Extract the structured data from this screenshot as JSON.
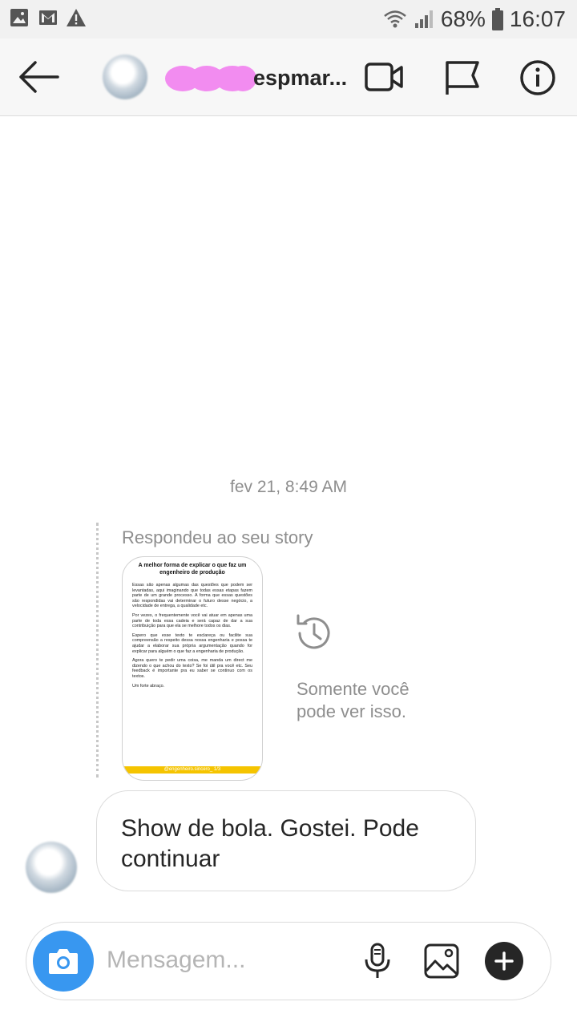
{
  "status_bar": {
    "battery": "68%",
    "time": "16:07",
    "left_icons": [
      "image-icon",
      "gmail-icon",
      "warning-icon"
    ],
    "right_icons": [
      "wifi-icon",
      "signal-icon",
      "battery-icon"
    ]
  },
  "header": {
    "username": "espmar...",
    "icons": [
      "back-arrow-icon",
      "video-call-icon",
      "flag-icon",
      "info-icon"
    ]
  },
  "chat": {
    "timestamp": "fev 21, 8:49 AM",
    "story_reply": {
      "label": "Respondeu ao seu story",
      "story_title": "A melhor forma de explicar o que faz um engenheiro de produção",
      "story_paragraphs": [
        "Essas são apenas algumas das questões que podem ser levantadas, aqui imaginando que todas essas etapas fazem parte de um grande processo. A forma que essas questões são respondidas vai determinar o futuro desse negócio, a velocidade de entrega, a qualidade etc.",
        "Por vezes, o frequentemente você vai atuar em apenas uma parte de toda essa cadeia e será capaz de dar a sua contribuição para que ela se melhore todos os dias.",
        "Espero que esse texto te esclareça ou facilite sua compreensão a respeito dessa nossa engenharia e possa te ajudar a elaborar sua própria argumentação quando for explicar para alguém o que faz a engenharia de produção.",
        "Agora quero te pedir uma coisa, me manda um direct me dizendo o que achou do texto? Se foi útil pra você etc. Seu feedback é importante pra eu saber se continuo com os textos.",
        "Um forte abraço."
      ],
      "story_footer": "@engenheiro.sincero_     1/3",
      "private_note": [
        "Somente você",
        "pode ver isso."
      ]
    },
    "message": "Show de bola.  Gostei.  Pode continuar"
  },
  "composer": {
    "placeholder": "Mensagem...",
    "icons": [
      "camera-icon",
      "microphone-icon",
      "gallery-icon",
      "plus-icon"
    ]
  },
  "colors": {
    "accent": "#3897f0",
    "username_blur": "#f28cf0",
    "story_bar": "#f5c400",
    "muted_text": "#8e8e8e"
  }
}
